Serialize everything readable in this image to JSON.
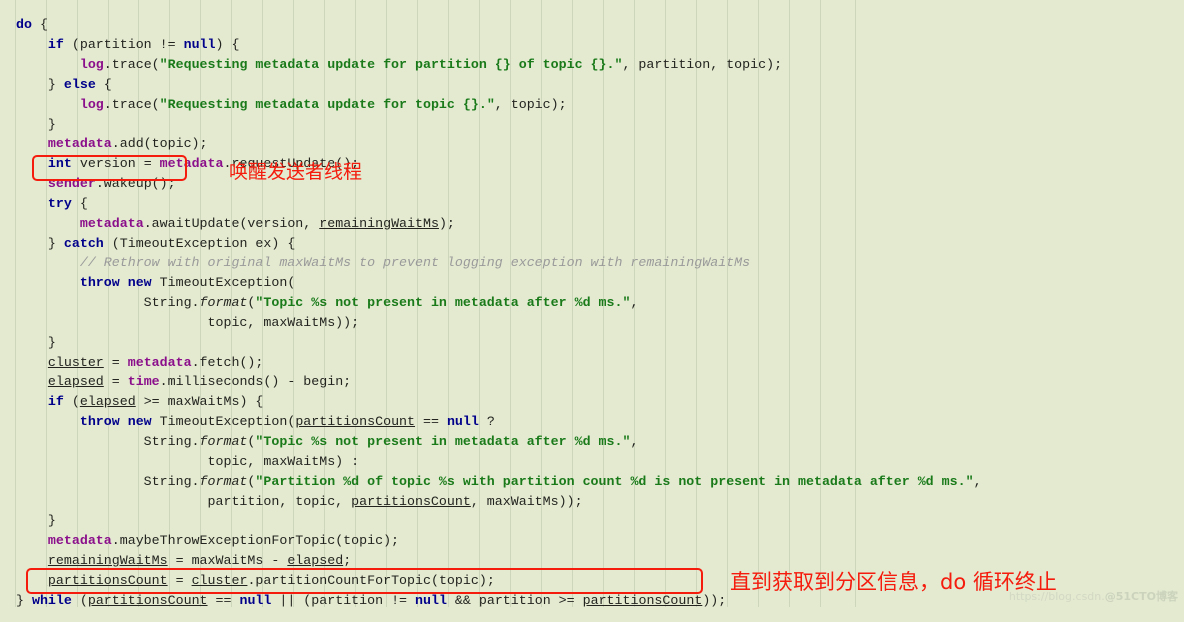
{
  "editor": {
    "background_color": "#e3ead0",
    "guide_color": "#cdd6bb",
    "font_size_px": 13.3,
    "line_height_px": 19.85,
    "guide_x_positions": [
      15,
      46,
      77,
      108,
      138,
      169,
      200,
      231,
      262,
      293,
      324,
      355,
      386,
      417,
      448,
      479,
      510,
      541,
      572,
      603,
      634,
      665,
      696,
      727,
      758,
      789,
      820,
      855
    ],
    "language": "java",
    "colors": {
      "keyword": "#00008b",
      "field": "#8b0f8b",
      "string": "#1a7a1a",
      "comment": "#9a9a9a",
      "plain": "#23241f",
      "annotation_red": "#f51b0d"
    }
  },
  "code": {
    "lines": [
      [
        {
          "t": "do",
          "c": "kw"
        },
        {
          "t": " {",
          "c": "pl"
        }
      ],
      [
        {
          "t": "    ",
          "c": "pl"
        },
        {
          "t": "if",
          "c": "kw"
        },
        {
          "t": " (partition != ",
          "c": "pl"
        },
        {
          "t": "null",
          "c": "kw"
        },
        {
          "t": ") {",
          "c": "pl"
        }
      ],
      [
        {
          "t": "        ",
          "c": "pl"
        },
        {
          "t": "log",
          "c": "fld"
        },
        {
          "t": ".trace(",
          "c": "pl"
        },
        {
          "t": "\"Requesting metadata update for partition {} of topic {}.\"",
          "c": "str"
        },
        {
          "t": ", partition, topic);",
          "c": "pl"
        }
      ],
      [
        {
          "t": "    } ",
          "c": "pl"
        },
        {
          "t": "else",
          "c": "kw"
        },
        {
          "t": " {",
          "c": "pl"
        }
      ],
      [
        {
          "t": "        ",
          "c": "pl"
        },
        {
          "t": "log",
          "c": "fld"
        },
        {
          "t": ".trace(",
          "c": "pl"
        },
        {
          "t": "\"Requesting metadata update for topic {}.\"",
          "c": "str"
        },
        {
          "t": ", topic);",
          "c": "pl"
        }
      ],
      [
        {
          "t": "    }",
          "c": "pl"
        }
      ],
      [
        {
          "t": "    ",
          "c": "pl"
        },
        {
          "t": "metadata",
          "c": "fld"
        },
        {
          "t": ".add(topic);",
          "c": "pl"
        }
      ],
      [
        {
          "t": "    ",
          "c": "pl"
        },
        {
          "t": "int",
          "c": "kw"
        },
        {
          "t": " version = ",
          "c": "pl"
        },
        {
          "t": "metadata",
          "c": "fld"
        },
        {
          "t": ".requestUpdate();",
          "c": "pl"
        }
      ],
      [
        {
          "t": "    ",
          "c": "pl"
        },
        {
          "t": "sender",
          "c": "fld"
        },
        {
          "t": ".wakeup();",
          "c": "pl"
        }
      ],
      [
        {
          "t": "    ",
          "c": "pl"
        },
        {
          "t": "try",
          "c": "kw"
        },
        {
          "t": " {",
          "c": "pl"
        }
      ],
      [
        {
          "t": "        ",
          "c": "pl"
        },
        {
          "t": "metadata",
          "c": "fld"
        },
        {
          "t": ".awaitUpdate(version, ",
          "c": "pl"
        },
        {
          "t": "remainingWaitMs",
          "c": "loc"
        },
        {
          "t": ");",
          "c": "pl"
        }
      ],
      [
        {
          "t": "    } ",
          "c": "pl"
        },
        {
          "t": "catch",
          "c": "kw"
        },
        {
          "t": " (TimeoutException ex) {",
          "c": "pl"
        }
      ],
      [
        {
          "t": "        ",
          "c": "pl"
        },
        {
          "t": "// Rethrow with original maxWaitMs to prevent logging exception with remainingWaitMs",
          "c": "cmt"
        }
      ],
      [
        {
          "t": "        ",
          "c": "pl"
        },
        {
          "t": "throw new",
          "c": "kw"
        },
        {
          "t": " TimeoutException(",
          "c": "pl"
        }
      ],
      [
        {
          "t": "                String.",
          "c": "pl"
        },
        {
          "t": "format",
          "c": "it"
        },
        {
          "t": "(",
          "c": "pl"
        },
        {
          "t": "\"Topic %s not present in metadata after %d ms.\"",
          "c": "str"
        },
        {
          "t": ",",
          "c": "pl"
        }
      ],
      [
        {
          "t": "                        topic, maxWaitMs));",
          "c": "pl"
        }
      ],
      [
        {
          "t": "    }",
          "c": "pl"
        }
      ],
      [
        {
          "t": "    ",
          "c": "pl"
        },
        {
          "t": "cluster",
          "c": "loc"
        },
        {
          "t": " = ",
          "c": "pl"
        },
        {
          "t": "metadata",
          "c": "fld"
        },
        {
          "t": ".fetch();",
          "c": "pl"
        }
      ],
      [
        {
          "t": "    ",
          "c": "pl"
        },
        {
          "t": "elapsed",
          "c": "loc"
        },
        {
          "t": " = ",
          "c": "pl"
        },
        {
          "t": "time",
          "c": "fld"
        },
        {
          "t": ".milliseconds() - begin;",
          "c": "pl"
        }
      ],
      [
        {
          "t": "    ",
          "c": "pl"
        },
        {
          "t": "if",
          "c": "kw"
        },
        {
          "t": " (",
          "c": "pl"
        },
        {
          "t": "elapsed",
          "c": "loc"
        },
        {
          "t": " >= maxWaitMs) {",
          "c": "pl"
        }
      ],
      [
        {
          "t": "        ",
          "c": "pl"
        },
        {
          "t": "throw new",
          "c": "kw"
        },
        {
          "t": " TimeoutException(",
          "c": "pl"
        },
        {
          "t": "partitionsCount",
          "c": "loc"
        },
        {
          "t": " == ",
          "c": "pl"
        },
        {
          "t": "null",
          "c": "kw"
        },
        {
          "t": " ?",
          "c": "pl"
        }
      ],
      [
        {
          "t": "                String.",
          "c": "pl"
        },
        {
          "t": "format",
          "c": "it"
        },
        {
          "t": "(",
          "c": "pl"
        },
        {
          "t": "\"Topic %s not present in metadata after %d ms.\"",
          "c": "str"
        },
        {
          "t": ",",
          "c": "pl"
        }
      ],
      [
        {
          "t": "                        topic, maxWaitMs) :",
          "c": "pl"
        }
      ],
      [
        {
          "t": "                String.",
          "c": "pl"
        },
        {
          "t": "format",
          "c": "it"
        },
        {
          "t": "(",
          "c": "pl"
        },
        {
          "t": "\"Partition %d of topic %s with partition count %d is not present in metadata after %d ms.\"",
          "c": "str"
        },
        {
          "t": ",",
          "c": "pl"
        }
      ],
      [
        {
          "t": "                        partition, topic, ",
          "c": "pl"
        },
        {
          "t": "partitionsCount",
          "c": "loc"
        },
        {
          "t": ", maxWaitMs));",
          "c": "pl"
        }
      ],
      [
        {
          "t": "    }",
          "c": "pl"
        }
      ],
      [
        {
          "t": "    ",
          "c": "pl"
        },
        {
          "t": "metadata",
          "c": "fld"
        },
        {
          "t": ".maybeThrowExceptionForTopic(topic);",
          "c": "pl"
        }
      ],
      [
        {
          "t": "    ",
          "c": "pl"
        },
        {
          "t": "remainingWaitMs",
          "c": "loc"
        },
        {
          "t": " = maxWaitMs - ",
          "c": "pl"
        },
        {
          "t": "elapsed",
          "c": "loc"
        },
        {
          "t": ";",
          "c": "pl"
        }
      ],
      [
        {
          "t": "    ",
          "c": "pl"
        },
        {
          "t": "partitionsCount",
          "c": "loc"
        },
        {
          "t": " = ",
          "c": "pl"
        },
        {
          "t": "cluster",
          "c": "loc"
        },
        {
          "t": ".partitionCountForTopic(topic);",
          "c": "pl"
        }
      ],
      [
        {
          "t": "} ",
          "c": "pl"
        },
        {
          "t": "while",
          "c": "kw"
        },
        {
          "t": " (",
          "c": "pl"
        },
        {
          "t": "partitionsCount",
          "c": "loc"
        },
        {
          "t": " == ",
          "c": "pl"
        },
        {
          "t": "null",
          "c": "kw"
        },
        {
          "t": " || (partition != ",
          "c": "pl"
        },
        {
          "t": "null",
          "c": "kw"
        },
        {
          "t": " && partition >= ",
          "c": "pl"
        },
        {
          "t": "partitionsCount",
          "c": "loc"
        },
        {
          "t": "));",
          "c": "pl"
        }
      ]
    ]
  },
  "annotations": [
    {
      "id": "wakeup",
      "text": "唤醒发送者线程",
      "color": "#f51b0d",
      "target_code": "sender.wakeup();"
    },
    {
      "id": "while",
      "text": "直到获取到分区信息，do 循环终止",
      "color": "#f51b0d",
      "target_code": "} while (partitionsCount == null || (partition != null && partition >= partitionsCount));"
    }
  ],
  "watermark": {
    "url_text": "https://blog.csdn.",
    "brand_text": "@51CTO博客"
  }
}
